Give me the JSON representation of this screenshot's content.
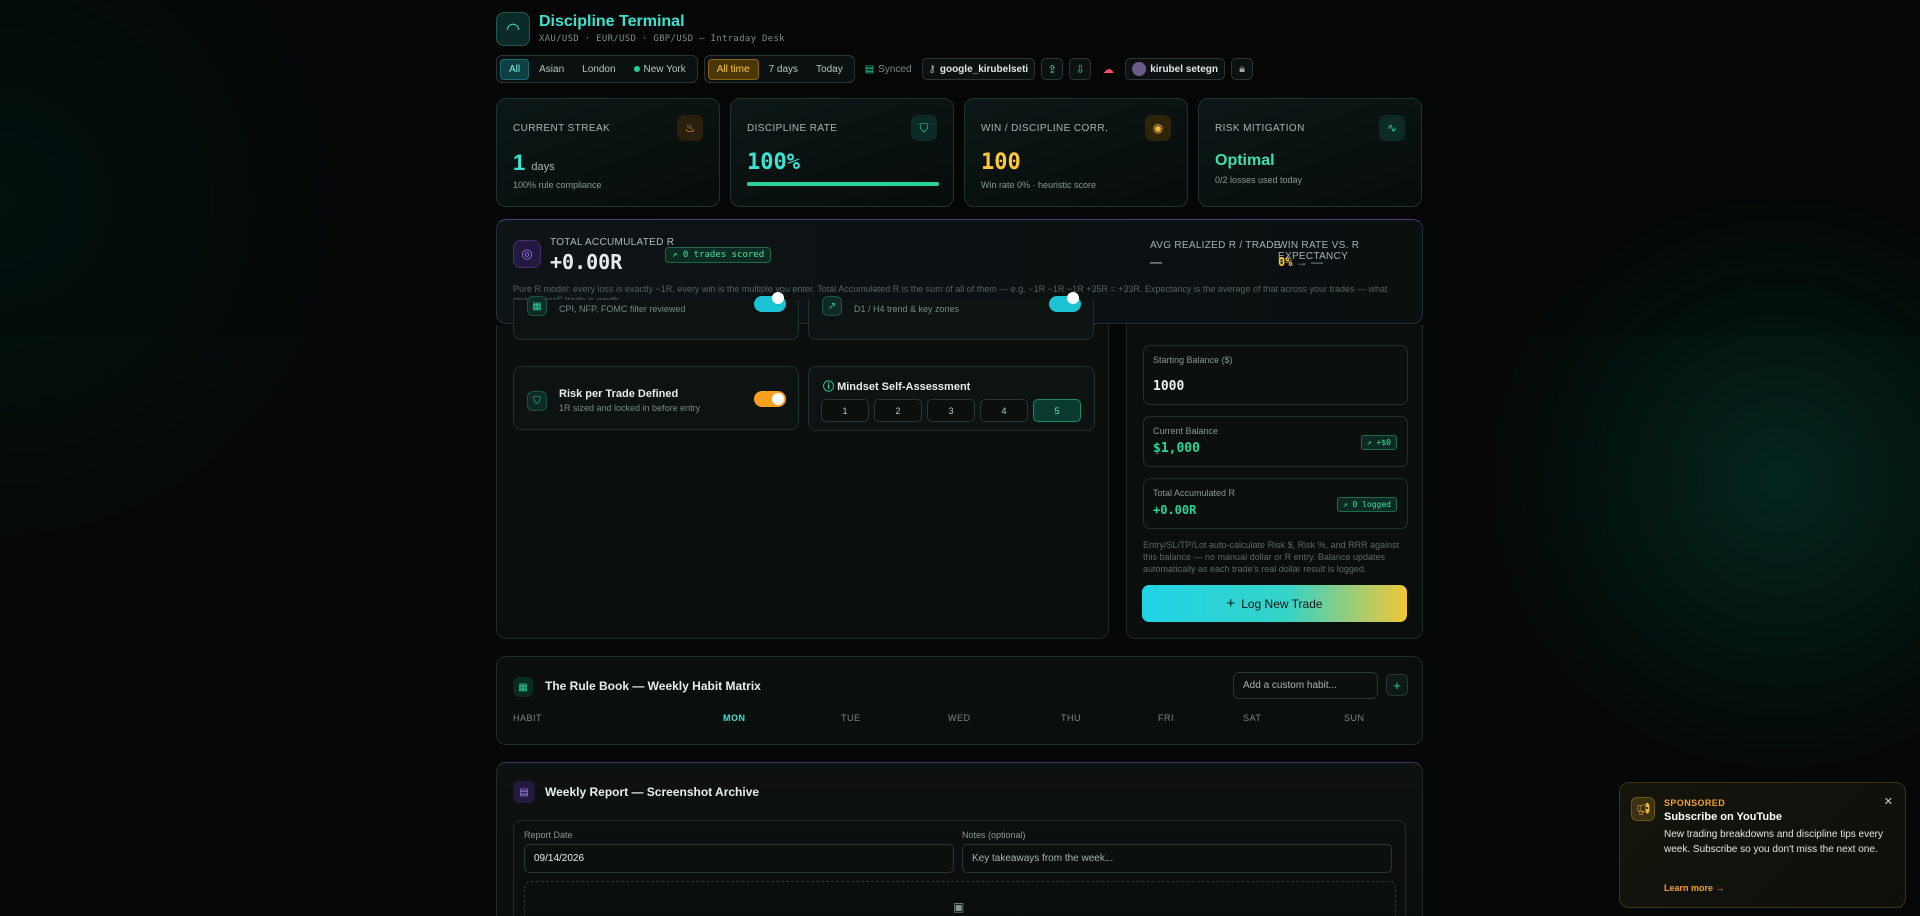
{
  "app": {
    "title": "Discipline Terminal",
    "subtitle": "XAU/USD · EUR/USD · GBP/USD — Intraday Desk"
  },
  "toolbar": {
    "sessions": [
      "All",
      "Asian",
      "London",
      "New York"
    ],
    "ranges": [
      "All time",
      "7 days",
      "Today"
    ],
    "synced": "Synced",
    "account_id": "google_kirubelseti",
    "user_name": "kirubel setegn"
  },
  "stats": {
    "streak": {
      "label": "CURRENT STREAK",
      "value": "1",
      "unit": "days",
      "sub": "100% rule compliance"
    },
    "discipline": {
      "label": "DISCIPLINE RATE",
      "value": "100%",
      "progress": 1.0
    },
    "win_corr": {
      "label": "WIN / DISCIPLINE CORR.",
      "value": "100",
      "sub": "Win rate 0% · heuristic score"
    },
    "risk": {
      "label": "RISK MITIGATION",
      "value": "Optimal",
      "sub": "0/2 losses used today"
    }
  },
  "total_r": {
    "label": "TOTAL ACCUMULATED R",
    "value": "+0.00R",
    "pill": "↗ 0 trades scored",
    "avg_label": "AVG REALIZED R / TRADE",
    "avg_value": "—",
    "wr_label": "WIN RATE VS. R EXPECTANCY",
    "wr_value": "0%",
    "wr_expect": "→ —",
    "description": "Pure R model: every loss is exactly −1R, every win is the multiple you enter. Total Accumulated R is the sum of all of them — e.g. −1R −1R −1R +35R = +33R. Expectancy is the average of that across your trades — what one \"typical\" trade is worth."
  },
  "checklist": {
    "news_sub": "CPI, NFP, FOMC filter reviewed",
    "trend_sub": "D1 / H4 trend & key zones",
    "risk_title": "Risk per Trade Defined",
    "risk_sub": "1R sized and locked in before entry"
  },
  "mindset": {
    "title": "Mindset Self-Assessment",
    "options": [
      "1",
      "2",
      "3",
      "4",
      "5"
    ],
    "selected": "5"
  },
  "balance": {
    "starting_label": "Starting Balance ($)",
    "starting_value": "1000",
    "current_label": "Current Balance",
    "current_value": "$1,000",
    "current_tag": "↗ +$0",
    "accum_label": "Total Accumulated R",
    "accum_value": "+0.00R",
    "accum_tag": "↗ 0 logged",
    "note": "Entry/SL/TP/Lot auto-calculate Risk $, Risk %, and RRR against this balance — no manual dollar or R entry. Balance updates automatically as each trade's real dollar result is logged.",
    "cta": "Log New Trade"
  },
  "rulebook": {
    "title": "The Rule Book — Weekly Habit Matrix",
    "input_placeholder": "Add a custom habit...",
    "headers": [
      "HABIT",
      "MON",
      "TUE",
      "WED",
      "THU",
      "FRI",
      "SAT",
      "SUN"
    ]
  },
  "report": {
    "title": "Weekly Report — Screenshot Archive",
    "date_label": "Report Date",
    "date_value": "09/14/2026",
    "notes_label": "Notes (optional)",
    "notes_placeholder": "Key takeaways from the week..."
  },
  "toast": {
    "tag": "SPONSORED",
    "title": "Subscribe on YouTube",
    "body": "New trading breakdowns and discipline tips every week. Subscribe so you don't miss the next one.",
    "link": "Learn more →"
  },
  "colors": {
    "accent_cyan": "#3be3d0",
    "accent_green": "#27d59a",
    "accent_amber": "#ffc83a",
    "accent_orange": "#f7a01f"
  }
}
